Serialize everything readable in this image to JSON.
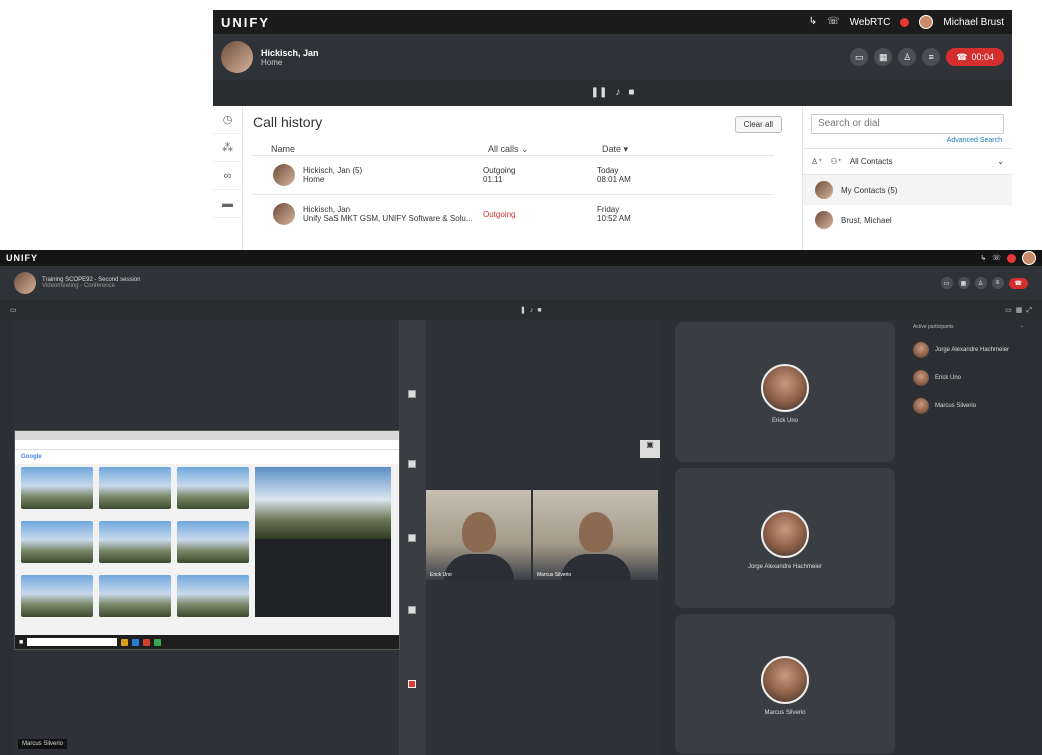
{
  "top": {
    "brand": "UNIFY",
    "webrtc": "WebRTC",
    "user": "Michael Brust",
    "call": {
      "name": "Hickisch, Jan",
      "status": "Home",
      "timer": "00:04"
    },
    "history": {
      "title": "Call history",
      "clear_label": "Clear all",
      "col_name": "Name",
      "col_filter": "All calls",
      "col_date": "Date",
      "rows": [
        {
          "name": "Hickisch, Jan (5)",
          "sub": "Home",
          "dir": "Outgoing",
          "dur": "01:11",
          "day": "Today",
          "time": "08:01 AM"
        },
        {
          "name": "Hickisch, Jan",
          "sub": "Unify SaS MKT GSM, UNIFY Software & Solu...",
          "dir": "Outgoing",
          "dur": "",
          "day": "Friday",
          "time": "10:52 AM"
        }
      ]
    },
    "search": {
      "placeholder": "Search or dial",
      "advanced": "Advanced Search"
    },
    "contacts": {
      "filter": "All Contacts",
      "group": "My Contacts (5)",
      "first": "Brust, Michael"
    }
  },
  "bottom": {
    "brand": "UNIFY",
    "conf_title": "Training SCOPE92 - Second session",
    "conf_sub": "Videomeeting - Conference",
    "presenter_label": "Marcus Silverio",
    "video_labels": [
      "Erick Uno",
      "Marcus Silverio"
    ],
    "participants_header": "Active participants",
    "participants": [
      "Jorge Alexandre Hachmeier",
      "Erick Uno",
      "Marcus Silverio"
    ],
    "tiles": [
      "Erick Uno",
      "Jorge Alexandre Hachmeier",
      "Marcus Silverio"
    ],
    "browser_search": "Google"
  },
  "colors": {
    "accent_red": "#d32f2f",
    "dark_bg": "#2c2f33",
    "link_blue": "#1a7ab8"
  }
}
